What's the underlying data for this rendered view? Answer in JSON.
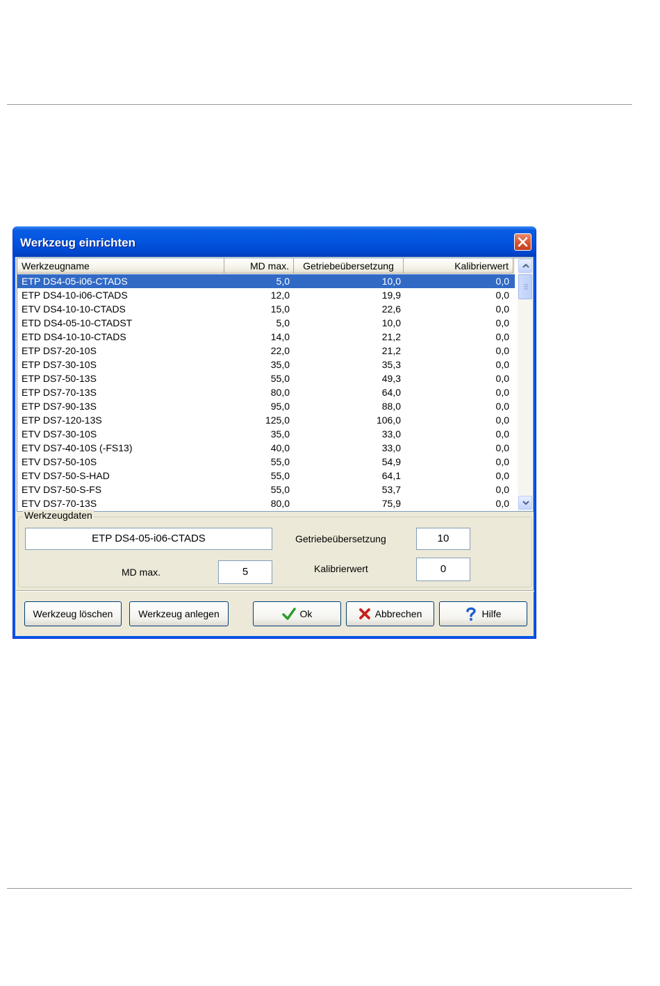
{
  "window": {
    "title": "Werkzeug einrichten"
  },
  "list": {
    "columns": [
      "Werkzeugname",
      "MD max.",
      "Getriebeübersetzung",
      "Kalibrierwert"
    ],
    "rows": [
      [
        "ETP DS4-05-i06-CTADS",
        "5,0",
        "10,0",
        "0,0"
      ],
      [
        "ETP DS4-10-i06-CTADS",
        "12,0",
        "19,9",
        "0,0"
      ],
      [
        "ETV DS4-10-10-CTADS",
        "15,0",
        "22,6",
        "0,0"
      ],
      [
        "ETD DS4-05-10-CTADST",
        "5,0",
        "10,0",
        "0,0"
      ],
      [
        "ETD DS4-10-10-CTADS",
        "14,0",
        "21,2",
        "0,0"
      ],
      [
        "ETP DS7-20-10S",
        "22,0",
        "21,2",
        "0,0"
      ],
      [
        "ETP DS7-30-10S",
        "35,0",
        "35,3",
        "0,0"
      ],
      [
        "ETP DS7-50-13S",
        "55,0",
        "49,3",
        "0,0"
      ],
      [
        "ETP DS7-70-13S",
        "80,0",
        "64,0",
        "0,0"
      ],
      [
        "ETP DS7-90-13S",
        "95,0",
        "88,0",
        "0,0"
      ],
      [
        "ETP DS7-120-13S",
        "125,0",
        "106,0",
        "0,0"
      ],
      [
        "ETV DS7-30-10S",
        "35,0",
        "33,0",
        "0,0"
      ],
      [
        "ETV DS7-40-10S  (-FS13)",
        "40,0",
        "33,0",
        "0,0"
      ],
      [
        "ETV DS7-50-10S",
        "55,0",
        "54,9",
        "0,0"
      ],
      [
        "ETV DS7-50-S-HAD",
        "55,0",
        "64,1",
        "0,0"
      ],
      [
        "ETV DS7-50-S-FS",
        "55,0",
        "53,7",
        "0,0"
      ],
      [
        "ETV DS7-70-13S",
        "80,0",
        "75,9",
        "0,0"
      ]
    ],
    "selected_index": 0
  },
  "details": {
    "caption": "Werkzeugdaten",
    "name_value": "ETP DS4-05-i06-CTADS",
    "md_label": "MD max.",
    "md_value": "5",
    "gear_label": "Getriebeübersetzung",
    "gear_value": "10",
    "cal_label": "Kalibrierwert",
    "cal_value": "0"
  },
  "buttons": {
    "delete": "Werkzeug löschen",
    "create": "Werkzeug anlegen",
    "ok": "Ok",
    "cancel": "Abbrechen",
    "help": "Hilfe"
  },
  "colors": {
    "titlebar": "#0054e3",
    "selection": "#316ac5",
    "dialog_face": "#ece9d8",
    "ok_icon": "#2f9d2f",
    "cancel_icon": "#c8201c",
    "help_icon": "#1f5fd0"
  },
  "icons": {
    "close": "close-icon",
    "scroll_up": "chevron-up-icon",
    "scroll_down": "chevron-down-icon",
    "ok": "checkmark-icon",
    "cancel": "cross-icon",
    "help": "question-mark-icon"
  }
}
